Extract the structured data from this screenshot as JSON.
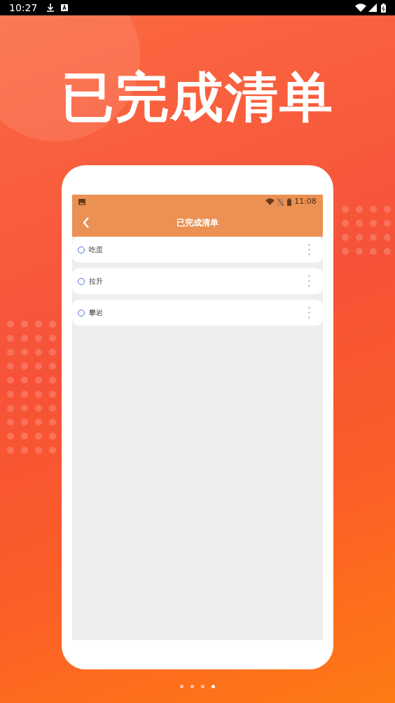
{
  "status_bar": {
    "time": "10:27"
  },
  "headline": "已完成清单",
  "phone": {
    "status_bar": {
      "time": "11:08"
    },
    "title": "已完成清单",
    "tasks": [
      {
        "name": "吃蛋",
        "checked": false
      },
      {
        "name": "拉升",
        "checked": false
      },
      {
        "name": "攀岩",
        "checked": false
      }
    ]
  },
  "page_dots": [
    {
      "selected": false
    },
    {
      "selected": false
    },
    {
      "selected": false
    },
    {
      "selected": true
    }
  ]
}
